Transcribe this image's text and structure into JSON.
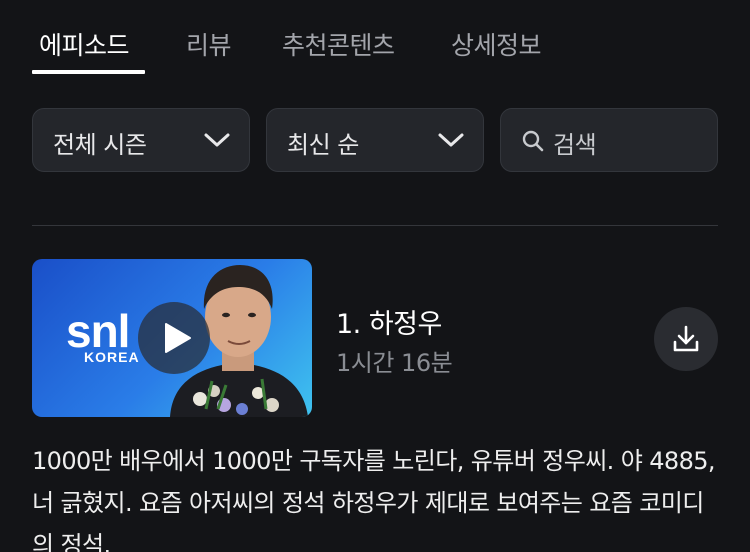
{
  "tabs": [
    {
      "label": "에피소드",
      "active": true
    },
    {
      "label": "리뷰",
      "active": false
    },
    {
      "label": "추천콘텐츠",
      "active": false
    },
    {
      "label": "상세정보",
      "active": false
    }
  ],
  "filters": {
    "season": {
      "value": "전체 시즌",
      "icon": "chevron-down-icon"
    },
    "sort": {
      "value": "최신 순",
      "icon": "chevron-down-icon"
    },
    "search": {
      "placeholder": "검색",
      "icon": "search-icon"
    }
  },
  "episode": {
    "title": "1. 하정우",
    "duration": "1시간 16분",
    "thumbnail": {
      "logo": "snl",
      "logo_sub": "KOREA"
    },
    "description": "1000만 배우에서 1000만 구독자를 노린다, 유튜버 정우씨. 야 4885, 너 긁혔지. 요즘 아저씨의 정석 하정우가 제대로 보여주는 요즘 코미디의 정석."
  },
  "colors": {
    "background": "#131417",
    "surface": "#24262b",
    "text_primary": "#ffffff",
    "text_secondary": "#8a8d93"
  }
}
